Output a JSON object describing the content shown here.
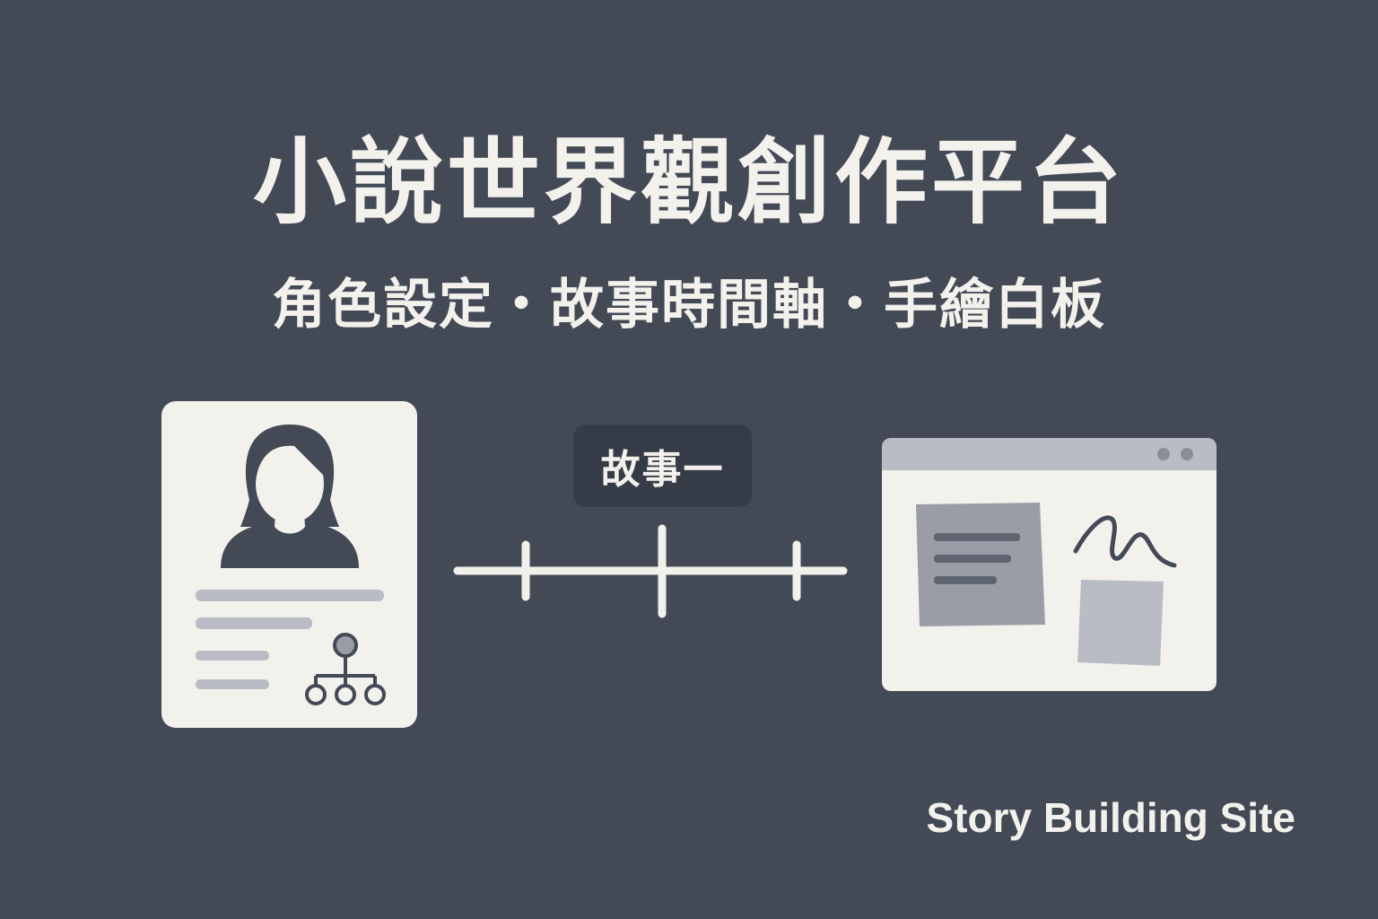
{
  "hero": {
    "title": "小說世界觀創作平台",
    "subtitle": "角色設定・故事時間軸・手繪白板"
  },
  "timeline": {
    "label": "故事一"
  },
  "brand": {
    "name": "Story Building Site"
  },
  "icons": {
    "character_card": "person-profile-icon",
    "relationship": "hierarchy-tree-icon",
    "timeline": "timeline-icon",
    "whiteboard": "whiteboard-window-icon",
    "scribble": "scribble-icon",
    "sticky_note": "sticky-note-icon"
  },
  "colors": {
    "background": "#434a56",
    "card": "#f3f1ec",
    "dark": "#434a56",
    "muted": "#b9bcc4",
    "accent_gray": "#9a9da6"
  }
}
